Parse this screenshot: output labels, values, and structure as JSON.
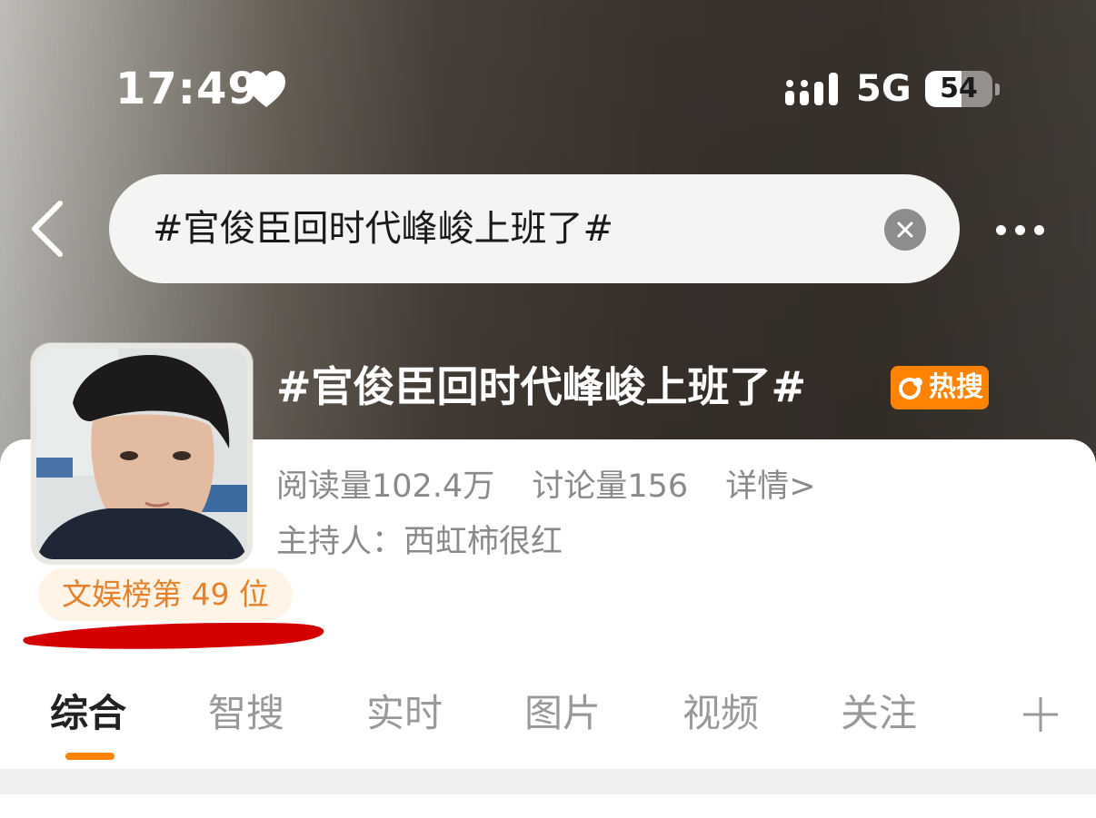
{
  "status_bar": {
    "time": "17:49",
    "network": "5G",
    "battery": "54",
    "battery_level": 0.54
  },
  "search": {
    "query": "#官俊臣回时代峰峻上班了#"
  },
  "topic": {
    "title": "#官俊臣回时代峰峻上班了#",
    "hot_badge": "热搜",
    "read_count": "阅读量102.4万",
    "discussion_count": "讨论量156",
    "details_link": "详情>",
    "host": "主持人：西虹柿很红",
    "rank": "文娱榜第 49 位"
  },
  "tabs": [
    {
      "label": "综合",
      "active": true
    },
    {
      "label": "智搜"
    },
    {
      "label": "实时"
    },
    {
      "label": "图片"
    },
    {
      "label": "视频"
    },
    {
      "label": "关注"
    }
  ],
  "colors": {
    "accent": "#ff8200",
    "rank_text": "#e4812a",
    "rank_bg": "#fff4e6",
    "highlight_mark": "#d40000"
  },
  "icons": [
    "heart-icon",
    "signal-icon",
    "back-icon",
    "clear-icon",
    "more-icon",
    "hot-search-icon",
    "plus-icon"
  ]
}
